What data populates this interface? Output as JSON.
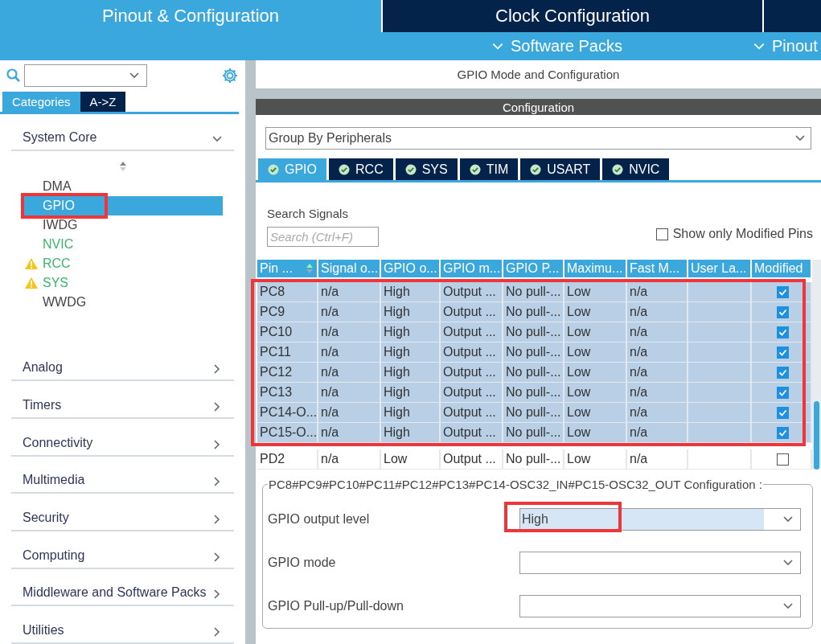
{
  "header": {
    "tabs": [
      {
        "label": "Pinout & Configuration",
        "selected": true
      },
      {
        "label": "Clock Configuration",
        "selected": false
      }
    ],
    "menus": [
      {
        "label": "Software Packs"
      },
      {
        "label": "Pinout"
      }
    ]
  },
  "sidebar": {
    "tabs": [
      {
        "label": "Categories",
        "selected": true
      },
      {
        "label": "A->Z",
        "selected": false
      }
    ],
    "categories": [
      {
        "label": "System Core",
        "expanded": true,
        "children": [
          {
            "label": "DMA",
            "kind": "normal",
            "selected": false,
            "highlighted": false
          },
          {
            "label": "GPIO",
            "kind": "normal",
            "selected": true,
            "highlighted": true
          },
          {
            "label": "IWDG",
            "kind": "normal",
            "selected": false,
            "highlighted": false
          },
          {
            "label": "NVIC",
            "kind": "ok",
            "selected": false,
            "highlighted": false
          },
          {
            "label": "RCC",
            "kind": "warning",
            "selected": false,
            "highlighted": false
          },
          {
            "label": "SYS",
            "kind": "warning",
            "selected": false,
            "highlighted": false
          },
          {
            "label": "WWDG",
            "kind": "normal",
            "selected": false,
            "highlighted": false
          }
        ]
      },
      {
        "label": "Analog",
        "expanded": false
      },
      {
        "label": "Timers",
        "expanded": false
      },
      {
        "label": "Connectivity",
        "expanded": false
      },
      {
        "label": "Multimedia",
        "expanded": false
      },
      {
        "label": "Security",
        "expanded": false
      },
      {
        "label": "Computing",
        "expanded": false
      },
      {
        "label": "Middleware and Software Packs",
        "expanded": false
      },
      {
        "label": "Utilities",
        "expanded": false
      }
    ]
  },
  "panel": {
    "title": "GPIO Mode and Configuration",
    "config_title": "Configuration",
    "group_by": "Group By Peripherals",
    "tabs": [
      {
        "label": "GPIO",
        "selected": true
      },
      {
        "label": "RCC",
        "selected": false
      },
      {
        "label": "SYS",
        "selected": false
      },
      {
        "label": "TIM",
        "selected": false
      },
      {
        "label": "USART",
        "selected": false
      },
      {
        "label": "NVIC",
        "selected": false
      }
    ],
    "search_label": "Search Signals",
    "search_placeholder": "Search (Ctrl+F)",
    "show_modified": {
      "label": "Show only Modified Pins",
      "checked": false
    },
    "table": {
      "highlighted": true,
      "columns": [
        "Pin ...",
        "Signal o...",
        "GPIO o...",
        "GPIO m...",
        "GPIO P...",
        "Maximu...",
        "Fast M...",
        "User La...",
        "Modified"
      ],
      "rows": [
        {
          "cells": [
            "PC8",
            "n/a",
            "High",
            "Output ...",
            "No pull-...",
            "Low",
            "n/a"
          ],
          "modified": true,
          "selected": true
        },
        {
          "cells": [
            "PC9",
            "n/a",
            "High",
            "Output ...",
            "No pull-...",
            "Low",
            "n/a"
          ],
          "modified": true,
          "selected": true
        },
        {
          "cells": [
            "PC10",
            "n/a",
            "High",
            "Output ...",
            "No pull-...",
            "Low",
            "n/a"
          ],
          "modified": true,
          "selected": true
        },
        {
          "cells": [
            "PC11",
            "n/a",
            "High",
            "Output ...",
            "No pull-...",
            "Low",
            "n/a"
          ],
          "modified": true,
          "selected": true
        },
        {
          "cells": [
            "PC12",
            "n/a",
            "High",
            "Output ...",
            "No pull-...",
            "Low",
            "n/a"
          ],
          "modified": true,
          "selected": true
        },
        {
          "cells": [
            "PC13",
            "n/a",
            "High",
            "Output ...",
            "No pull-...",
            "Low",
            "n/a"
          ],
          "modified": true,
          "selected": true
        },
        {
          "cells": [
            "PC14-O...",
            "n/a",
            "High",
            "Output ...",
            "No pull-...",
            "Low",
            "n/a"
          ],
          "modified": true,
          "selected": true
        },
        {
          "cells": [
            "PC15-O...",
            "n/a",
            "High",
            "Output ...",
            "No pull-...",
            "Low",
            "n/a"
          ],
          "modified": true,
          "selected": true
        },
        {
          "cells": [
            "PD2",
            "n/a",
            "Low",
            "Output ...",
            "No pull-...",
            "Low",
            "n/a"
          ],
          "modified": false,
          "selected": false
        }
      ]
    },
    "config": {
      "legend": "PC8#PC9#PC10#PC11#PC12#PC13#PC14-OSC32_IN#PC15-OSC32_OUT Configuration :",
      "fields": [
        {
          "label": "GPIO output level",
          "value": "High",
          "selected": true,
          "highlighted": true
        },
        {
          "label": "GPIO mode",
          "selected": false,
          "highlighted": false
        },
        {
          "label": "GPIO Pull-up/Pull-down",
          "selected": false,
          "highlighted": false
        }
      ]
    }
  }
}
